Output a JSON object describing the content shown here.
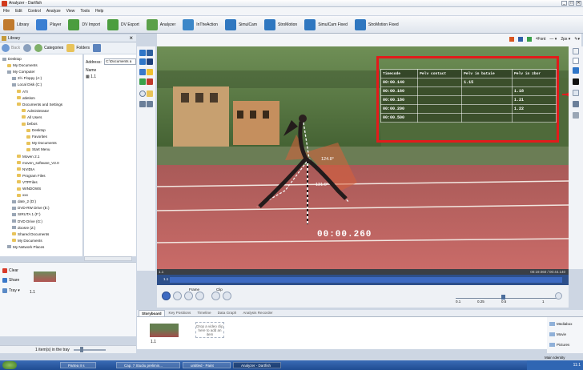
{
  "window": {
    "title": "Analyzer - Dartfish",
    "controls": [
      "_",
      "□",
      "✕"
    ]
  },
  "menu": [
    "File",
    "Edit",
    "Control",
    "Analyze",
    "View",
    "Tools",
    "Help"
  ],
  "toolbar": [
    {
      "label": "Library",
      "color": "#c07a2d"
    },
    {
      "label": "Player",
      "color": "#3a7fd2"
    },
    {
      "label": "DV Import",
      "color": "#4b9d3f"
    },
    {
      "label": "DV Export",
      "color": "#4b9d3f"
    },
    {
      "label": "Analyzer",
      "color": "#5aa04a"
    },
    {
      "label": "InTheAction",
      "color": "#3c87c8"
    },
    {
      "label": "SimulCam",
      "color": "#2f77c0"
    },
    {
      "label": "StroMotion",
      "color": "#2f77c0"
    },
    {
      "label": "SimulCam Fixed",
      "color": "#2f77c0"
    },
    {
      "label": "StroMotion Fixed",
      "color": "#2f77c0"
    }
  ],
  "library": {
    "title": "Library",
    "nav": {
      "back": "Back",
      "categories": "Categories",
      "folders": "Folders"
    },
    "address_label": "Address:",
    "address_value": "C:\\Documents a",
    "column_name": "Name",
    "item": "1.1",
    "tree": [
      {
        "label": "Desktop",
        "indent": 0,
        "kind": "drive"
      },
      {
        "label": "My Documents",
        "indent": 1,
        "kind": "folder"
      },
      {
        "label": "My Computer",
        "indent": 1,
        "kind": "drive"
      },
      {
        "label": "3½ Floppy (A:)",
        "indent": 2,
        "kind": "drive"
      },
      {
        "label": "Local Disk (C:)",
        "indent": 2,
        "kind": "drive"
      },
      {
        "label": "ATI",
        "indent": 3,
        "kind": "folder"
      },
      {
        "label": "atletism",
        "indent": 3,
        "kind": "folder"
      },
      {
        "label": "Documents and Settings",
        "indent": 3,
        "kind": "folder"
      },
      {
        "label": "Administrator",
        "indent": 4,
        "kind": "folder"
      },
      {
        "label": "All Users",
        "indent": 4,
        "kind": "folder"
      },
      {
        "label": "bebos",
        "indent": 4,
        "kind": "folder"
      },
      {
        "label": "Desktop",
        "indent": 5,
        "kind": "folder"
      },
      {
        "label": "Favorites",
        "indent": 5,
        "kind": "folder"
      },
      {
        "label": "My Documents",
        "indent": 5,
        "kind": "folder"
      },
      {
        "label": "Start Menu",
        "indent": 5,
        "kind": "folder"
      },
      {
        "label": "Moven 2.1",
        "indent": 3,
        "kind": "folder"
      },
      {
        "label": "moven_software_V2.0",
        "indent": 3,
        "kind": "folder"
      },
      {
        "label": "NVIDIA",
        "indent": 3,
        "kind": "folder"
      },
      {
        "label": "Program Files",
        "indent": 3,
        "kind": "folder"
      },
      {
        "label": "VTPFiles",
        "indent": 3,
        "kind": "folder"
      },
      {
        "label": "WINDOWS",
        "indent": 3,
        "kind": "folder"
      },
      {
        "label": "xxx",
        "indent": 3,
        "kind": "folder"
      },
      {
        "label": "date_2 (D:)",
        "indent": 2,
        "kind": "drive"
      },
      {
        "label": "DVD-RW Drive (E:)",
        "indent": 2,
        "kind": "drive"
      },
      {
        "label": "SIRUTA 1 (F:)",
        "indent": 2,
        "kind": "drive"
      },
      {
        "label": "DVD Drive (G:)",
        "indent": 2,
        "kind": "drive"
      },
      {
        "label": "doosre (Z:)",
        "indent": 2,
        "kind": "drive"
      },
      {
        "label": "Shared Documents",
        "indent": 2,
        "kind": "folder"
      },
      {
        "label": "My Documents",
        "indent": 2,
        "kind": "folder"
      },
      {
        "label": "My Network Places",
        "indent": 1,
        "kind": "drive"
      }
    ],
    "actions": [
      {
        "label": "Clear",
        "color": "#d83a2a"
      },
      {
        "label": "Share",
        "color": "#3a78c9"
      },
      {
        "label": "Tray ▾",
        "color": "#5a8ac6"
      }
    ],
    "tray_item": "1.1",
    "status": "1 item(s) in the tray"
  },
  "video": {
    "timecode": "00:00.260",
    "angle1": "124.8°",
    "angle2": "131.0°",
    "overlay_table": {
      "headers": [
        "Timecode",
        "Pelv contact",
        "Pelv in bataie",
        "Pelv in zbor"
      ],
      "rows": [
        [
          "00:00.140",
          "",
          "1.15",
          ""
        ],
        [
          "00:00.160",
          "",
          "",
          "1.18"
        ],
        [
          "00:00.180",
          "",
          "",
          "1.21"
        ],
        [
          "00:00.200",
          "",
          "",
          "1.22"
        ],
        [
          "00:00.500",
          "",
          "",
          ""
        ]
      ]
    },
    "top_right": {
      "font": "Font",
      "stroke": "2px"
    }
  },
  "timeline": {
    "left": "1.1",
    "marker": "1.1",
    "right": "00:19.060 / 00:44.140"
  },
  "playback": {
    "frame_label": "Frame",
    "clip_label": "Clip",
    "speeds": [
      "0.1",
      "0.25",
      "0.5",
      "1"
    ]
  },
  "storyboard": {
    "tabs": [
      "Storyboard",
      "Key Positions",
      "Timeline",
      "Data Graph",
      "Analysis Recorder"
    ],
    "active_tab": "Storyboard",
    "thumb_label": "1.1",
    "drop_hint": "Drop a video clip here to add an item",
    "side": [
      "Mediabox",
      "Movie",
      "Pictures"
    ],
    "identity": "Main Identity"
  },
  "taskbar": {
    "items": [
      "Partea II s",
      "Cap. 7 Studiu prelimin...",
      "untitled - Paint",
      "Analyzer - Dartfish"
    ],
    "clock": "11:1"
  }
}
